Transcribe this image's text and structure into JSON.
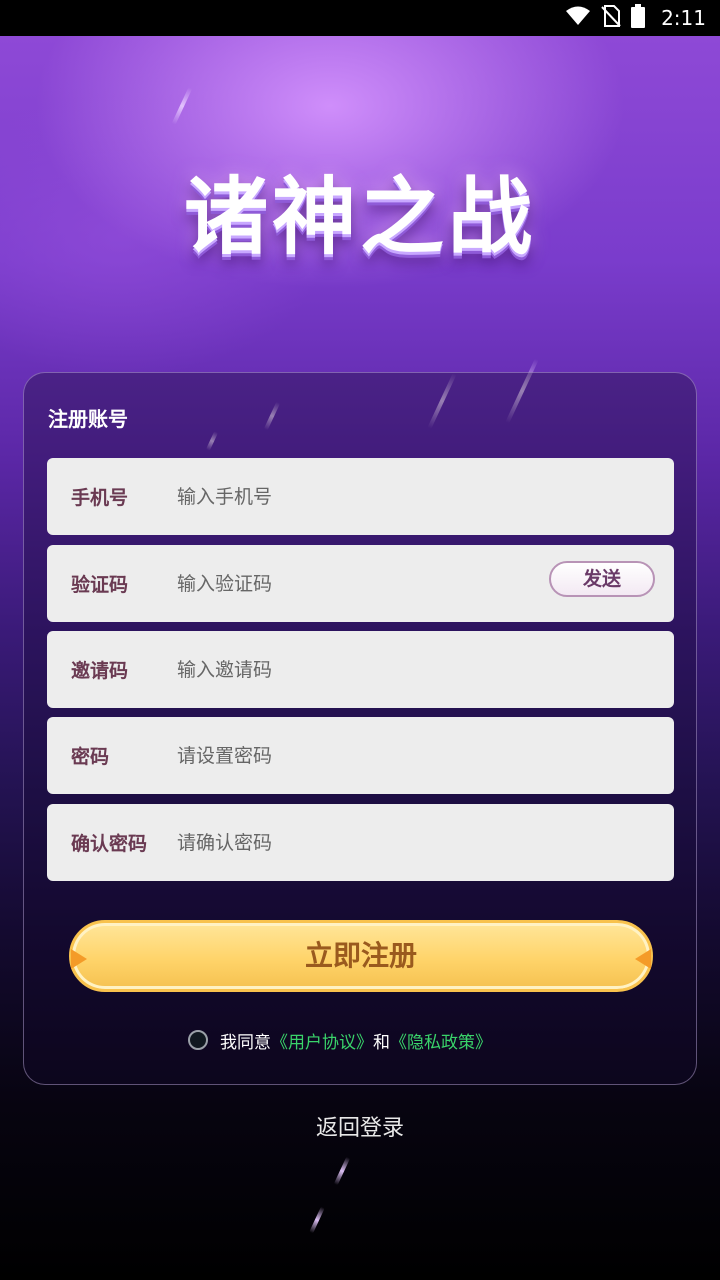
{
  "status_bar": {
    "time": "2:11",
    "icons": [
      "wifi-icon",
      "no-sim-icon",
      "battery-icon"
    ]
  },
  "app": {
    "logo_text": "诸神之战"
  },
  "panel": {
    "title": "注册账号",
    "fields": [
      {
        "label": "手机号",
        "placeholder": "输入手机号"
      },
      {
        "label": "验证码",
        "placeholder": "输入验证码",
        "action": "发送"
      },
      {
        "label": "邀请码",
        "placeholder": "输入邀请码"
      },
      {
        "label": "密码",
        "placeholder": "请设置密码"
      },
      {
        "label": "确认密码",
        "placeholder": "请确认密码"
      }
    ],
    "register_label": "立即注册",
    "agree": {
      "prefix": "我同意",
      "user_agreement": "《用户协议》",
      "and": "和",
      "privacy_policy": "《隐私政策》"
    }
  },
  "back_login_label": "返回登录",
  "colors": {
    "accent_button": "#ffd46a",
    "link": "#39d36a",
    "label": "#6a3a52"
  }
}
